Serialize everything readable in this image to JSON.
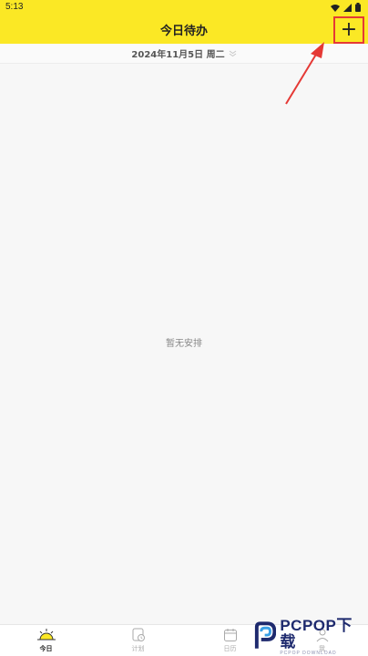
{
  "status_bar": {
    "time": "5:13",
    "icons": [
      "wifi-icon",
      "signal-icon",
      "battery-icon"
    ]
  },
  "header": {
    "title": "今日待办",
    "add_label": "+"
  },
  "date_bar": {
    "date": "2024年11月5日 周二"
  },
  "main": {
    "empty_text": "暂无安排"
  },
  "tabs": [
    {
      "label": "今日",
      "icon": "sun-icon",
      "active": true
    },
    {
      "label": "计划",
      "icon": "plan-icon",
      "active": false
    },
    {
      "label": "日历",
      "icon": "calendar-icon",
      "active": false
    },
    {
      "label": "我",
      "icon": "user-icon",
      "active": false
    }
  ],
  "watermark": {
    "brand": "PCPOP下载",
    "sub": "PCPOP DOWNLOAD"
  },
  "colors": {
    "header_bg": "#fbe825",
    "highlight": "#e53935",
    "annotation": "#e53935"
  }
}
